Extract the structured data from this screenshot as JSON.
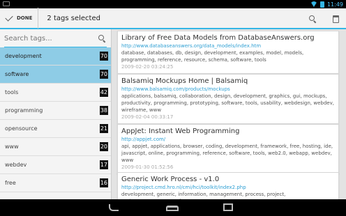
{
  "statusbar": {
    "time": "11:49"
  },
  "actionbar": {
    "done_label": "DONE",
    "selected_text": "2 tags selected",
    "icons": [
      "search-icon",
      "trash-icon"
    ]
  },
  "sidebar": {
    "search_placeholder": "Search tags...",
    "tags": [
      {
        "name": "development",
        "count": "70",
        "selected": true
      },
      {
        "name": "software",
        "count": "70",
        "selected": true
      },
      {
        "name": "tools",
        "count": "42",
        "selected": false
      },
      {
        "name": "programming",
        "count": "38",
        "selected": false
      },
      {
        "name": "opensource",
        "count": "21",
        "selected": false
      },
      {
        "name": "www",
        "count": "20",
        "selected": false
      },
      {
        "name": "webdev",
        "count": "17",
        "selected": false
      },
      {
        "name": "free",
        "count": "16",
        "selected": false
      }
    ]
  },
  "bookmarks": [
    {
      "title": "Library of Free Data Models from DatabaseAnswers.org",
      "url": "http://www.databaseanswers.org/data_models/index.htm",
      "tags": "database, databases, db, design, development, examples, model, models, programming, reference, resource, schema, software, tools",
      "date": "2009-02-20 03:24:25"
    },
    {
      "title": "Balsamiq Mockups Home | Balsamiq",
      "url": "http://www.balsamiq.com/products/mockups",
      "tags": "applications, balsamiq, collaboration, design, development, graphics, gui, mockups, productivity, programming, prototyping, software, tools, usability, webdesign, webdev, wireframe, www",
      "date": "2009-02-04 00:33:17"
    },
    {
      "title": "AppJet: Instant Web Programming",
      "url": "http://appjet.com/",
      "tags": "api, appjet, applications, browser, coding, development, framework, free, hosting, ide, javascript, online, programming, reference, software, tools, web2.0, webapp, webdev, www",
      "date": "2009-01-30 01:52:56"
    },
    {
      "title": "Generic Work Process - v1.0",
      "url": "http://project.cmd.hro.nl/cmi/hci/toolkit/index2.php",
      "tags": "development, generic, information, management, process, project, projectmanagement, reference,",
      "date": ""
    }
  ],
  "navbar": {
    "icons": [
      "back-icon",
      "home-icon",
      "recent-apps-icon"
    ]
  },
  "colors": {
    "accent": "#33b5e5",
    "selected_tag": "#8ecce6",
    "link": "#2e9fd3"
  }
}
